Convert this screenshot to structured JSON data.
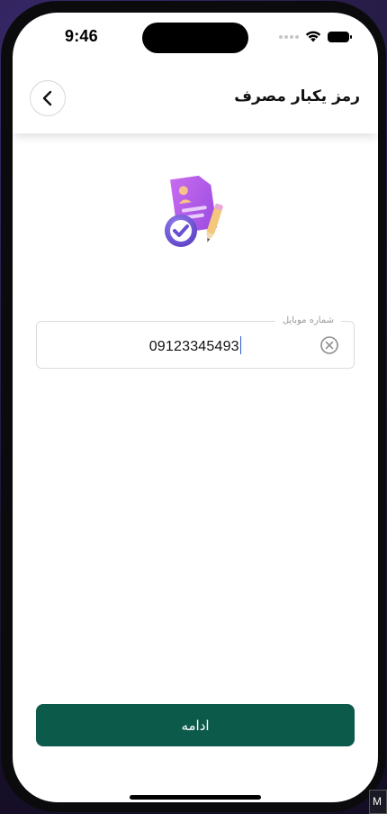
{
  "status_bar": {
    "time": "9:46",
    "icons": [
      "signal-dots-icon",
      "wifi-icon",
      "battery-icon"
    ]
  },
  "header": {
    "title": "رمز یکبار مصرف",
    "back_icon": "chevron-left-icon"
  },
  "illustration": {
    "icon": "document-check-pencil-illustration"
  },
  "phone_field": {
    "label": "شماره موبایل",
    "value": "09123345493",
    "clear_icon": "clear-circle-x-icon"
  },
  "actions": {
    "continue_label": "ادامه"
  },
  "colors": {
    "primary": "#0c5a4a",
    "caret": "#2f5bd0",
    "field_border": "#dcdcdc"
  },
  "corner_tag": {
    "text": "M"
  }
}
